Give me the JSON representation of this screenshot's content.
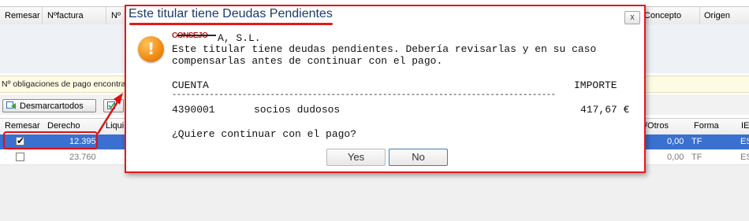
{
  "header_columns": [
    "Remesar",
    "Nºfactura",
    "Nº",
    "Concepto",
    "Origen"
  ],
  "info_text": "Nº obligaciones de pago encontra",
  "toolbar": {
    "desmarcar_label": "Desmarcartodos"
  },
  "grid_columns": [
    "Remesar",
    "Derecho",
    "Liqui",
    "/Otros",
    "Forma",
    "IE"
  ],
  "rows": [
    {
      "checked": true,
      "derecho": "12.395",
      "otros": "0,00",
      "forma": "TF",
      "ie": "ES"
    },
    {
      "checked": false,
      "derecho": "23.760",
      "otros": "0,00",
      "forma": "TF",
      "ie": "ES"
    }
  ],
  "dialog": {
    "title": "Este titular tiene Deudas Pendientes",
    "close_label": "x",
    "company_redacted": "CONSEJO",
    "company_suffix": "A, S.L.",
    "message_line1": "Este titular tiene deudas pendientes. Debería revisarlas y en su caso",
    "message_line2": "compensarlas antes de continuar con el pago.",
    "col_cuenta": "CUENTA",
    "col_importe": "IMPORTE",
    "separator": "----------------------------------------------------------------------------------",
    "entry": {
      "cuenta": "4390001",
      "descripcion": "socios dudosos",
      "importe": "417,67 €"
    },
    "question": "¿Quiere continuar con el pago?",
    "yes_label": "Yes",
    "no_label": "No"
  },
  "colors": {
    "annotation": "#e31a1a",
    "selection": "#3a70cf",
    "warning": "#f08b13"
  }
}
